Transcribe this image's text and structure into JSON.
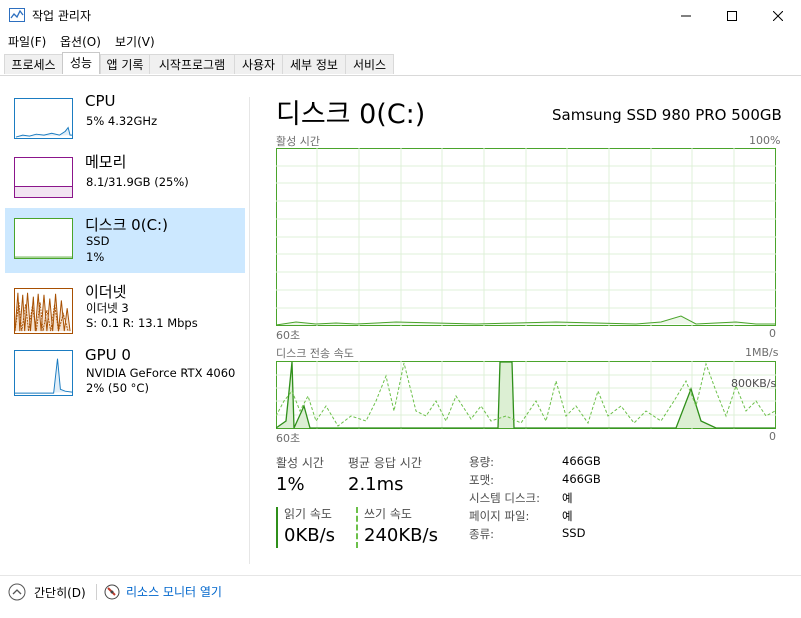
{
  "window": {
    "title": "작업 관리자"
  },
  "menu": [
    "파일(F)",
    "옵션(O)",
    "보기(V)"
  ],
  "tabs": [
    "프로세스",
    "성능",
    "앱 기록",
    "시작프로그램",
    "사용자",
    "세부 정보",
    "서비스"
  ],
  "active_tab": "성능",
  "sidebar": [
    {
      "name": "CPU",
      "sub1": "5% 4.32GHz",
      "sub2": "",
      "sub3": "",
      "color": "#1b7cc1"
    },
    {
      "name": "메모리",
      "sub1": "8.1/31.9GB (25%)",
      "sub2": "",
      "sub3": "",
      "color": "#8b158b"
    },
    {
      "name": "디스크 0(C:)",
      "sub1": "SSD",
      "sub2": "1%",
      "sub3": "",
      "color": "#4aa42b"
    },
    {
      "name": "이더넷",
      "sub1": "이더넷 3",
      "sub2": "S: 0.1  R: 13.1 Mbps",
      "sub3": "",
      "color": "#a74f01"
    },
    {
      "name": "GPU 0",
      "sub1": "NVIDIA GeForce RTX 4060",
      "sub2": "2% (50 °C)",
      "sub3": "",
      "color": "#1b7cc1"
    }
  ],
  "main": {
    "title": "디스크 0(C:)",
    "model": "Samsung SSD 980 PRO 500GB",
    "chart1": {
      "label": "활성 시간",
      "max": "100%",
      "x_left": "60초",
      "x_right": "0"
    },
    "chart2": {
      "label": "디스크 전송 속도",
      "max": "1MB/s",
      "mid": "800KB/s",
      "x_left": "60초",
      "x_right": "0"
    },
    "stats": {
      "active_label": "활성 시간",
      "active_value": "1%",
      "response_label": "평균 응답 시간",
      "response_value": "2.1ms",
      "read_label": "읽기 속도",
      "read_value": "0KB/s",
      "write_label": "쓰기 속도",
      "write_value": "240KB/s"
    },
    "details": [
      {
        "label": "용량:",
        "value": "466GB"
      },
      {
        "label": "포맷:",
        "value": "466GB"
      },
      {
        "label": "시스템 디스크:",
        "value": "예"
      },
      {
        "label": "페이지 파일:",
        "value": "예"
      },
      {
        "label": "종류:",
        "value": "SSD"
      }
    ]
  },
  "footer": {
    "collapse": "간단히(D)",
    "resmon": "리소스 모니터 열기"
  },
  "colors": {
    "accent": "#4aa42b",
    "selected": "#cce8ff",
    "grid": "#dff0d8"
  }
}
